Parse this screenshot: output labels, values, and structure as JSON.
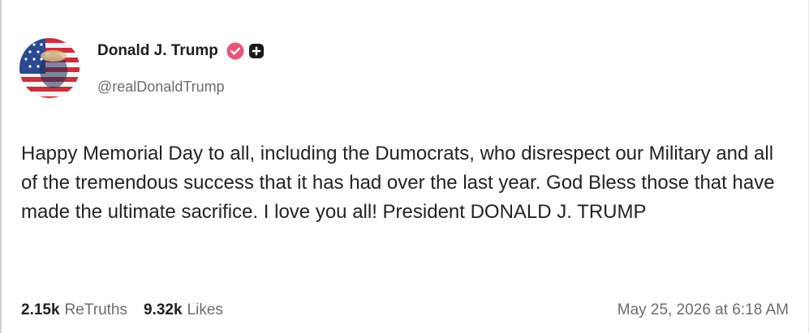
{
  "colors": {
    "verified_badge": "#e8547a",
    "name": "#1d1d22",
    "muted": "#6b6b72",
    "body": "#232326"
  },
  "profile": {
    "display_name": "Donald J. Trump",
    "handle": "@realDonaldTrump",
    "verified_icon": "verified-check-icon",
    "extra_icon": "plus-badge-icon"
  },
  "post": {
    "text": "Happy Memorial Day to all, including the Dumocrats, who disrespect our Military and all of the tremendous success that it has had over the last year. God Bless those that have made the ultimate sacrifice. I love you all! President DONALD J. TRUMP"
  },
  "footer": {
    "retruths_count": "2.15k",
    "retruths_label": "ReTruths",
    "likes_count": "9.32k",
    "likes_label": "Likes",
    "timestamp": "May 25, 2026 at 6:18 AM"
  }
}
